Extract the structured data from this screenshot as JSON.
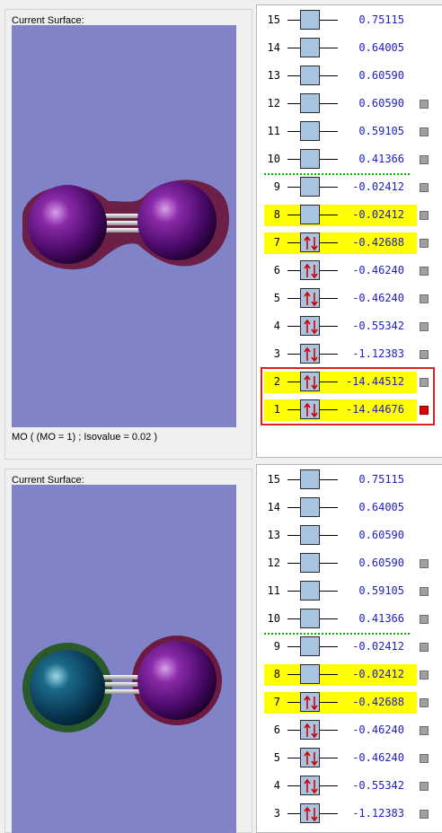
{
  "panels": [
    {
      "surface_title": "Current Surface:",
      "mo_caption": "MO ( (MO = 1) ; Isovalue = 0.02 )",
      "molecule": "purple-purple",
      "rows": [
        {
          "n": "15",
          "v": "0.75115",
          "occ": 0,
          "hl": false,
          "toggle": false
        },
        {
          "n": "14",
          "v": "0.64005",
          "occ": 0,
          "hl": false,
          "toggle": false
        },
        {
          "n": "13",
          "v": "0.60590",
          "occ": 0,
          "hl": false,
          "toggle": false
        },
        {
          "n": "12",
          "v": "0.60590",
          "occ": 0,
          "hl": false,
          "toggle": true
        },
        {
          "n": "11",
          "v": "0.59105",
          "occ": 0,
          "hl": false,
          "toggle": true
        },
        {
          "n": "10",
          "v": "0.41366",
          "occ": 0,
          "hl": false,
          "toggle": true
        },
        {
          "n": "9",
          "v": "-0.02412",
          "occ": 0,
          "hl": false,
          "toggle": true
        },
        {
          "n": "8",
          "v": "-0.02412",
          "occ": 0,
          "hl": true,
          "toggle": true
        },
        {
          "n": "7",
          "v": "-0.42688",
          "occ": 2,
          "hl": true,
          "toggle": true
        },
        {
          "n": "6",
          "v": "-0.46240",
          "occ": 2,
          "hl": false,
          "toggle": true
        },
        {
          "n": "5",
          "v": "-0.46240",
          "occ": 2,
          "hl": false,
          "toggle": true
        },
        {
          "n": "4",
          "v": "-0.55342",
          "occ": 2,
          "hl": false,
          "toggle": true
        },
        {
          "n": "3",
          "v": "-1.12383",
          "occ": 2,
          "hl": false,
          "toggle": true
        },
        {
          "n": "2",
          "v": "-14.44512",
          "occ": 2,
          "hl": true,
          "toggle": true
        },
        {
          "n": "1",
          "v": "-14.44676",
          "occ": 2,
          "hl": true,
          "toggle": true,
          "on": true
        }
      ]
    },
    {
      "surface_title": "Current Surface:",
      "molecule": "teal-purple",
      "rows": [
        {
          "n": "15",
          "v": "0.75115",
          "occ": 0,
          "hl": false,
          "toggle": false
        },
        {
          "n": "14",
          "v": "0.64005",
          "occ": 0,
          "hl": false,
          "toggle": false
        },
        {
          "n": "13",
          "v": "0.60590",
          "occ": 0,
          "hl": false,
          "toggle": false
        },
        {
          "n": "12",
          "v": "0.60590",
          "occ": 0,
          "hl": false,
          "toggle": true
        },
        {
          "n": "11",
          "v": "0.59105",
          "occ": 0,
          "hl": false,
          "toggle": true
        },
        {
          "n": "10",
          "v": "0.41366",
          "occ": 0,
          "hl": false,
          "toggle": true
        },
        {
          "n": "9",
          "v": "-0.02412",
          "occ": 0,
          "hl": false,
          "toggle": true
        },
        {
          "n": "8",
          "v": "-0.02412",
          "occ": 0,
          "hl": true,
          "toggle": true
        },
        {
          "n": "7",
          "v": "-0.42688",
          "occ": 2,
          "hl": true,
          "toggle": true
        },
        {
          "n": "6",
          "v": "-0.46240",
          "occ": 2,
          "hl": false,
          "toggle": true
        },
        {
          "n": "5",
          "v": "-0.46240",
          "occ": 2,
          "hl": false,
          "toggle": true
        },
        {
          "n": "4",
          "v": "-0.55342",
          "occ": 2,
          "hl": false,
          "toggle": true
        },
        {
          "n": "3",
          "v": "-1.12383",
          "occ": 2,
          "hl": false,
          "toggle": true
        }
      ]
    }
  ],
  "colors": {
    "viewport_bg": "#8183c9",
    "highlight": "#ffff00",
    "energy_text": "#2020c0",
    "orbital_box": "#a8c4e0",
    "selection": "#e02020",
    "homo_lumo_divider": "#00b000"
  }
}
